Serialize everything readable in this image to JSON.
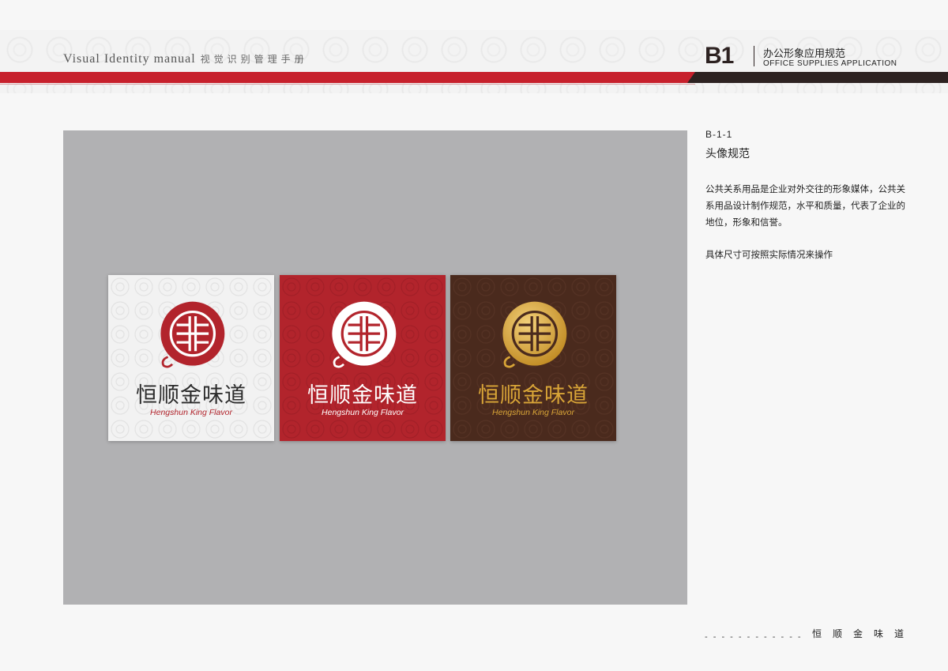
{
  "header": {
    "title_en": "Visual Identity  manual",
    "title_cn": "视觉识别管理手册",
    "section_code": "B1",
    "section_title_cn": "办公形象应用规范",
    "section_title_en": "OFFICE SUPPLIES APPLICATION",
    "colors": {
      "red": "#c7202c",
      "dark": "#2d2221"
    }
  },
  "tiles": [
    {
      "variant": "white",
      "cn_name": "恒顺金味道",
      "en_name": "Hengshun King Flavor",
      "background": "#f2f2f2",
      "logo_color": "#b2242c",
      "cn_color": "#2b2b2b",
      "en_color": "#b2242c"
    },
    {
      "variant": "red",
      "cn_name": "恒顺金味道",
      "en_name": "Hengshun King Flavor",
      "background": "#b2242c",
      "logo_color": "#ffffff",
      "cn_color": "#ffffff",
      "en_color": "#ffffff"
    },
    {
      "variant": "brown",
      "cn_name": "恒顺金味道",
      "en_name": "Hengshun King Flavor",
      "background": "#4a2a1d",
      "logo_color": "#d9a537",
      "cn_color": "#d9a537",
      "en_color": "#d9a537"
    }
  ],
  "content": {
    "code": "B-1-1",
    "subtitle": "头像规范",
    "description": "公共关系用品是企业对外交往的形象媒体，公共关系用品设计制作规范，水平和质量，代表了企业的地位，形象和信誉。",
    "note": "具体尺寸可按照实际情况来操作"
  },
  "footer": {
    "dashes": "- - - - - - - - - - - -",
    "brand": "恒顺金味道"
  }
}
